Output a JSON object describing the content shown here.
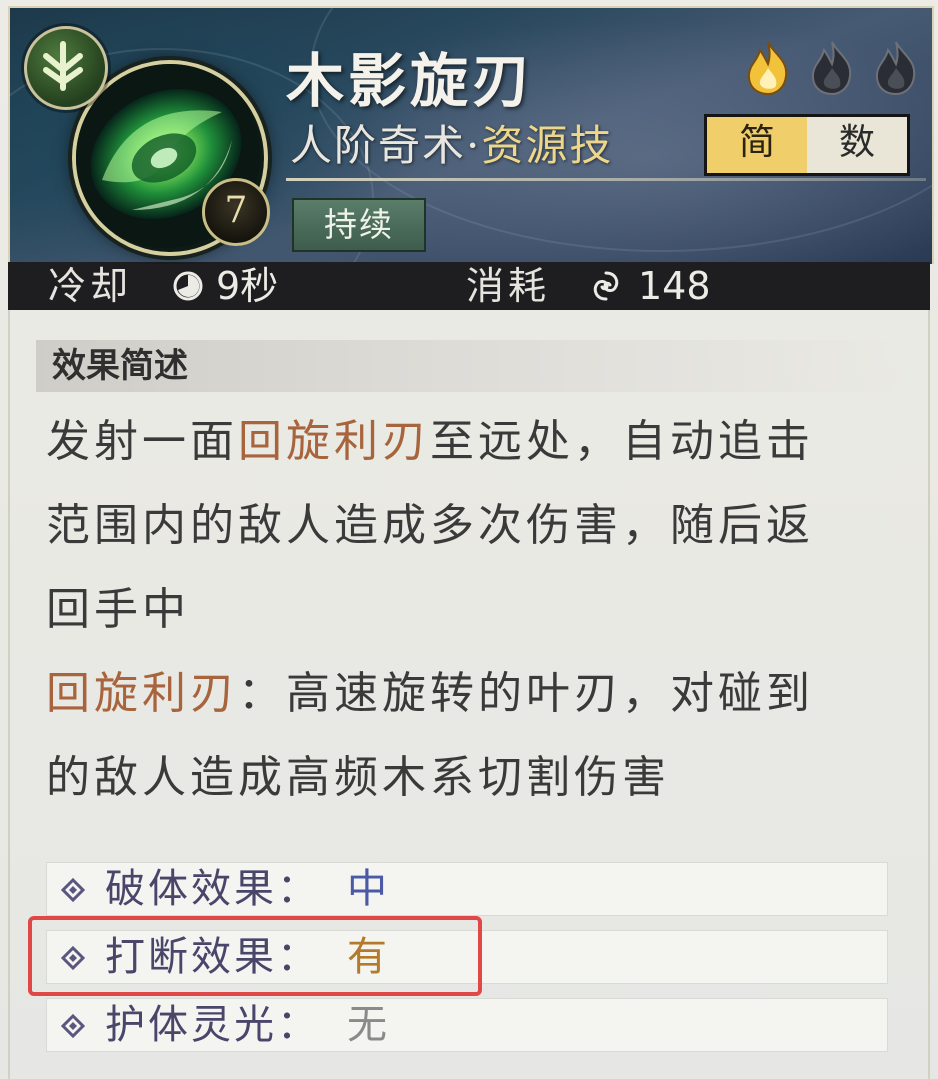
{
  "skill": {
    "name": "木影旋刃",
    "rank": "人阶奇术·",
    "category": "资源技",
    "level": "7",
    "tag": "持续",
    "element_icon": "wood-element-icon",
    "energy_flames": {
      "filled": 1,
      "total": 3,
      "filled_color": "#f2c23a",
      "empty_color": "#2a2d33"
    }
  },
  "view_toggle": {
    "simple": "简",
    "numeric": "数",
    "selected": "简"
  },
  "stats": {
    "cooldown_label": "冷却",
    "cooldown_value": "9秒",
    "cost_label": "消耗",
    "cost_value": "148"
  },
  "effect": {
    "section_title": "效果简述",
    "line1_a": "发射一面",
    "line1_hl": "回旋利刃",
    "line1_b": "至远处，自动追击",
    "line2": "范围内的敌人造成多次伤害，随后返",
    "line3": "回手中",
    "line4_hl": "回旋利刃",
    "line4_b": "：高速旋转的叶刃，对碰到",
    "line5": "的敌人造成高频木系切割伤害"
  },
  "attributes": [
    {
      "label": "破体效果：",
      "value": "中",
      "color": "#4a5aa6"
    },
    {
      "label": "打断效果：",
      "value": "有",
      "color": "#b27a2a"
    },
    {
      "label": "护体灵光：",
      "value": "无",
      "color": "#8a8a8a"
    }
  ],
  "colors": {
    "highlight_text": "#a8643c",
    "toggle_active": "#f0cf6a",
    "annotation_red": "#e04848"
  }
}
